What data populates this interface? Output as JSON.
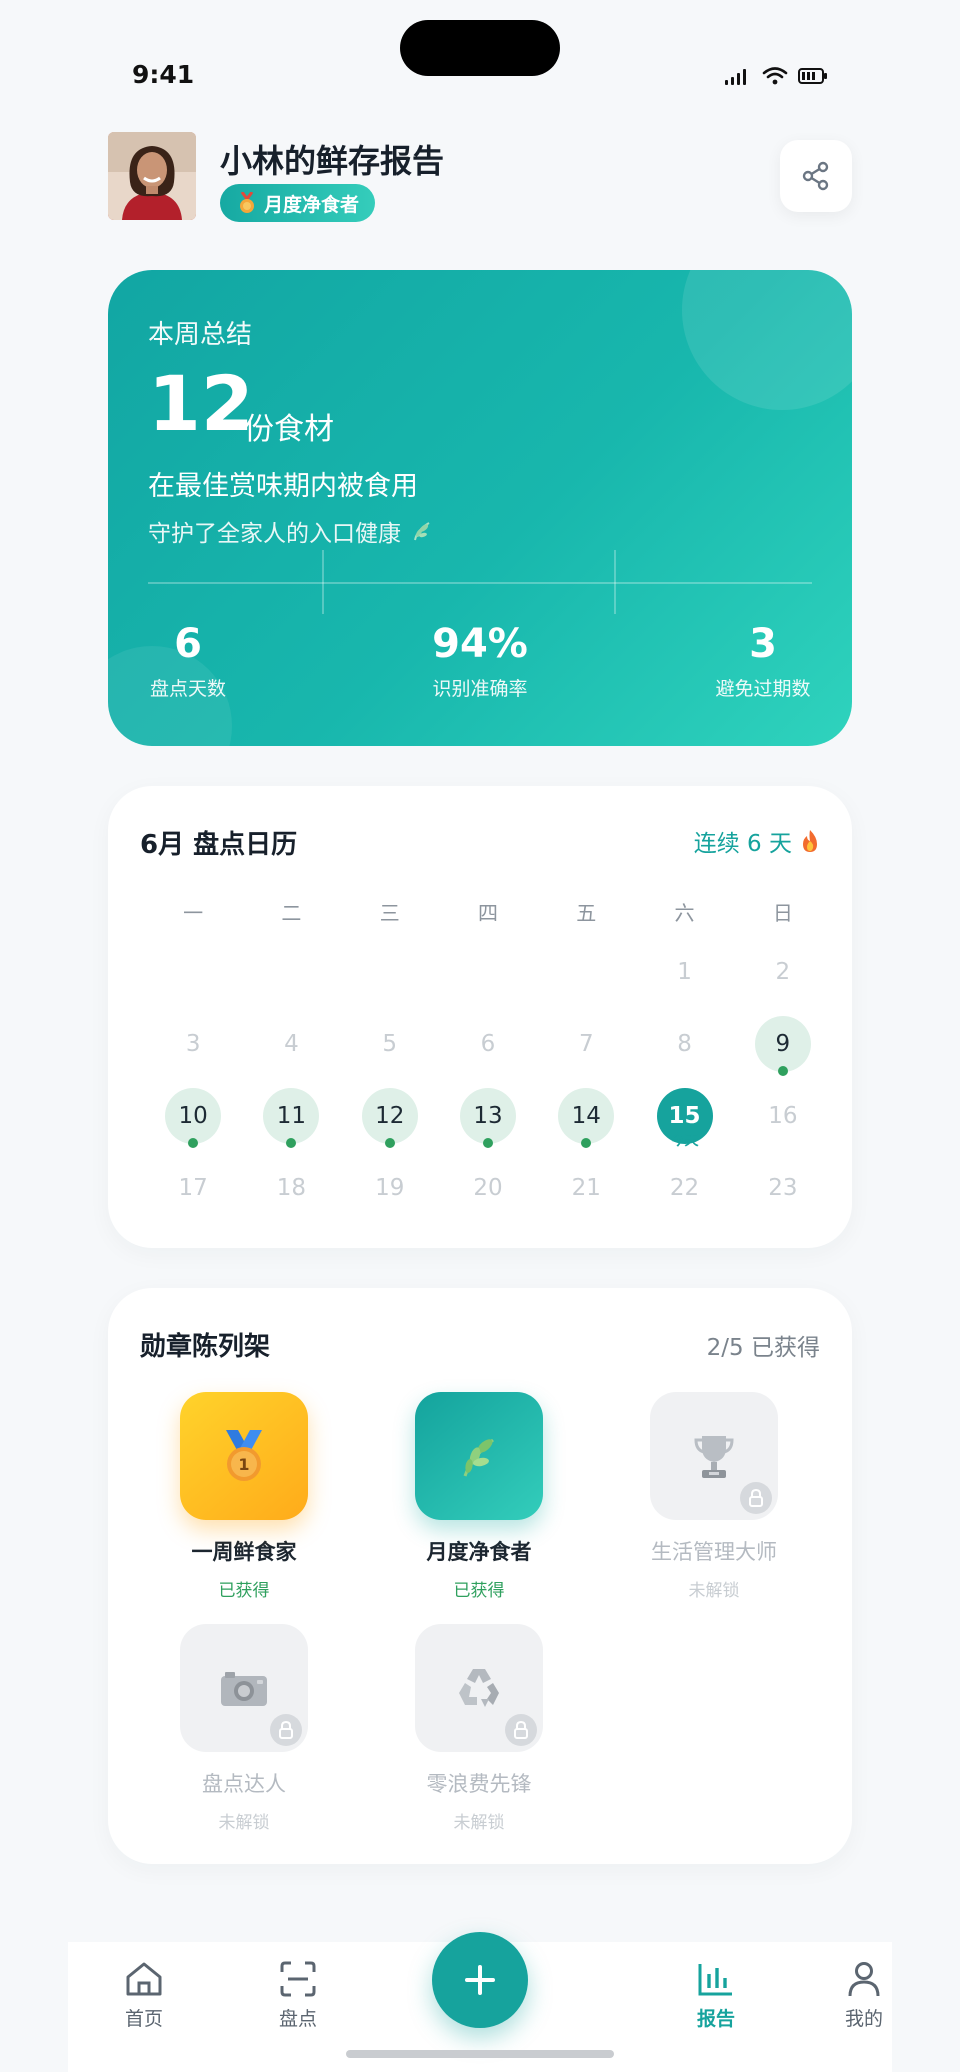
{
  "status_bar": {
    "time": "9:41"
  },
  "header": {
    "title": "小林的鲜存报告",
    "badge": "月度净食者"
  },
  "summary": {
    "label": "本周总结",
    "count": "12",
    "unit": "份食材",
    "line1": "在最佳赏味期内被食用",
    "line2": "守护了全家人的入口健康",
    "stats": [
      {
        "value": "6",
        "label": "盘点天数"
      },
      {
        "value": "94%",
        "label": "识别准确率"
      },
      {
        "value": "3",
        "label": "避免过期数"
      }
    ]
  },
  "calendar": {
    "title": "6月 盘点日历",
    "streak": "连续 6 天",
    "weekdays": [
      "一",
      "二",
      "三",
      "四",
      "五",
      "六",
      "日"
    ],
    "rows": [
      [
        "",
        "",
        "",
        "",
        "",
        "1",
        "2"
      ],
      [
        "3",
        "4",
        "5",
        "6",
        "7",
        "8",
        "9"
      ],
      [
        "10",
        "11",
        "12",
        "13",
        "14",
        "15",
        "16"
      ],
      [
        "17",
        "18",
        "19",
        "20",
        "21",
        "22",
        "23"
      ]
    ],
    "today_label": "今天"
  },
  "medals": {
    "title": "勋章陈列架",
    "count": "2/5 已获得",
    "items": [
      {
        "name": "一周鲜食家",
        "status": "已获得"
      },
      {
        "name": "月度净食者",
        "status": "已获得"
      },
      {
        "name": "生活管理大师",
        "status": "未解锁"
      },
      {
        "name": "盘点达人",
        "status": "未解锁"
      },
      {
        "name": "零浪费先锋",
        "status": "未解锁"
      }
    ]
  },
  "nav": {
    "items": [
      {
        "label": "首页",
        "icon": "home-icon"
      },
      {
        "label": "盘点",
        "icon": "scan-icon"
      },
      {
        "label": "报告",
        "icon": "chart-icon"
      },
      {
        "label": "我的",
        "icon": "user-icon"
      }
    ],
    "active": "报告",
    "accent": "#16a39d"
  }
}
